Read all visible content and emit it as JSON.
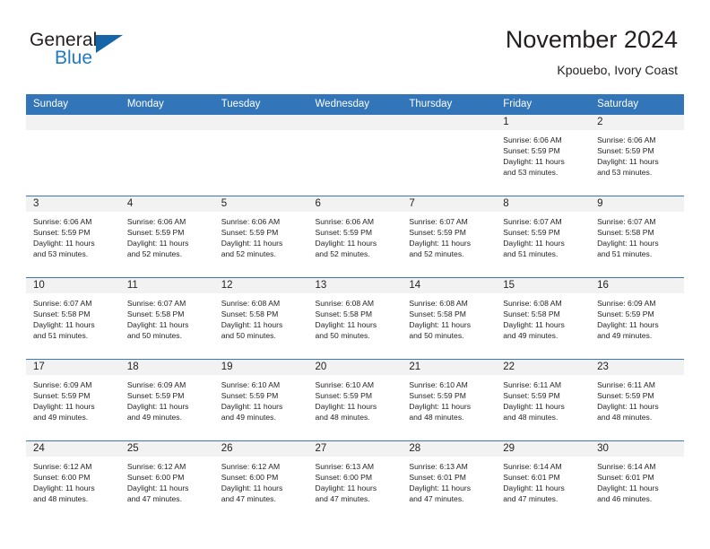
{
  "brand": {
    "name_part1": "General",
    "name_part2": "Blue",
    "flag_icon": "triangle-flag-icon"
  },
  "header": {
    "title": "November 2024",
    "location": "Kpouebo, Ivory Coast"
  },
  "colors": {
    "header_blue": "#3275b8",
    "brand_blue": "#1f7ac4",
    "flag_blue": "#1565a8",
    "daynum_bg": "#f2f2f2",
    "row_divider": "#3b78b5",
    "text": "#231f20"
  },
  "weekday_headers": [
    "Sunday",
    "Monday",
    "Tuesday",
    "Wednesday",
    "Thursday",
    "Friday",
    "Saturday"
  ],
  "labels": {
    "sunrise": "Sunrise:",
    "sunset": "Sunset:",
    "daylight": "Daylight:"
  },
  "weeks": [
    [
      {
        "day": "",
        "blank": true,
        "line1": "",
        "line2": "",
        "line3": "",
        "line4": ""
      },
      {
        "day": "",
        "blank": true,
        "line1": "",
        "line2": "",
        "line3": "",
        "line4": ""
      },
      {
        "day": "",
        "blank": true,
        "line1": "",
        "line2": "",
        "line3": "",
        "line4": ""
      },
      {
        "day": "",
        "blank": true,
        "line1": "",
        "line2": "",
        "line3": "",
        "line4": ""
      },
      {
        "day": "",
        "blank": true,
        "line1": "",
        "line2": "",
        "line3": "",
        "line4": ""
      },
      {
        "day": "1",
        "blank": false,
        "line1": "Sunrise: 6:06 AM",
        "line2": "Sunset: 5:59 PM",
        "line3": "Daylight: 11 hours",
        "line4": "and 53 minutes."
      },
      {
        "day": "2",
        "blank": false,
        "line1": "Sunrise: 6:06 AM",
        "line2": "Sunset: 5:59 PM",
        "line3": "Daylight: 11 hours",
        "line4": "and 53 minutes."
      }
    ],
    [
      {
        "day": "3",
        "blank": false,
        "line1": "Sunrise: 6:06 AM",
        "line2": "Sunset: 5:59 PM",
        "line3": "Daylight: 11 hours",
        "line4": "and 53 minutes."
      },
      {
        "day": "4",
        "blank": false,
        "line1": "Sunrise: 6:06 AM",
        "line2": "Sunset: 5:59 PM",
        "line3": "Daylight: 11 hours",
        "line4": "and 52 minutes."
      },
      {
        "day": "5",
        "blank": false,
        "line1": "Sunrise: 6:06 AM",
        "line2": "Sunset: 5:59 PM",
        "line3": "Daylight: 11 hours",
        "line4": "and 52 minutes."
      },
      {
        "day": "6",
        "blank": false,
        "line1": "Sunrise: 6:06 AM",
        "line2": "Sunset: 5:59 PM",
        "line3": "Daylight: 11 hours",
        "line4": "and 52 minutes."
      },
      {
        "day": "7",
        "blank": false,
        "line1": "Sunrise: 6:07 AM",
        "line2": "Sunset: 5:59 PM",
        "line3": "Daylight: 11 hours",
        "line4": "and 52 minutes."
      },
      {
        "day": "8",
        "blank": false,
        "line1": "Sunrise: 6:07 AM",
        "line2": "Sunset: 5:59 PM",
        "line3": "Daylight: 11 hours",
        "line4": "and 51 minutes."
      },
      {
        "day": "9",
        "blank": false,
        "line1": "Sunrise: 6:07 AM",
        "line2": "Sunset: 5:58 PM",
        "line3": "Daylight: 11 hours",
        "line4": "and 51 minutes."
      }
    ],
    [
      {
        "day": "10",
        "blank": false,
        "line1": "Sunrise: 6:07 AM",
        "line2": "Sunset: 5:58 PM",
        "line3": "Daylight: 11 hours",
        "line4": "and 51 minutes."
      },
      {
        "day": "11",
        "blank": false,
        "line1": "Sunrise: 6:07 AM",
        "line2": "Sunset: 5:58 PM",
        "line3": "Daylight: 11 hours",
        "line4": "and 50 minutes."
      },
      {
        "day": "12",
        "blank": false,
        "line1": "Sunrise: 6:08 AM",
        "line2": "Sunset: 5:58 PM",
        "line3": "Daylight: 11 hours",
        "line4": "and 50 minutes."
      },
      {
        "day": "13",
        "blank": false,
        "line1": "Sunrise: 6:08 AM",
        "line2": "Sunset: 5:58 PM",
        "line3": "Daylight: 11 hours",
        "line4": "and 50 minutes."
      },
      {
        "day": "14",
        "blank": false,
        "line1": "Sunrise: 6:08 AM",
        "line2": "Sunset: 5:58 PM",
        "line3": "Daylight: 11 hours",
        "line4": "and 50 minutes."
      },
      {
        "day": "15",
        "blank": false,
        "line1": "Sunrise: 6:08 AM",
        "line2": "Sunset: 5:58 PM",
        "line3": "Daylight: 11 hours",
        "line4": "and 49 minutes."
      },
      {
        "day": "16",
        "blank": false,
        "line1": "Sunrise: 6:09 AM",
        "line2": "Sunset: 5:59 PM",
        "line3": "Daylight: 11 hours",
        "line4": "and 49 minutes."
      }
    ],
    [
      {
        "day": "17",
        "blank": false,
        "line1": "Sunrise: 6:09 AM",
        "line2": "Sunset: 5:59 PM",
        "line3": "Daylight: 11 hours",
        "line4": "and 49 minutes."
      },
      {
        "day": "18",
        "blank": false,
        "line1": "Sunrise: 6:09 AM",
        "line2": "Sunset: 5:59 PM",
        "line3": "Daylight: 11 hours",
        "line4": "and 49 minutes."
      },
      {
        "day": "19",
        "blank": false,
        "line1": "Sunrise: 6:10 AM",
        "line2": "Sunset: 5:59 PM",
        "line3": "Daylight: 11 hours",
        "line4": "and 49 minutes."
      },
      {
        "day": "20",
        "blank": false,
        "line1": "Sunrise: 6:10 AM",
        "line2": "Sunset: 5:59 PM",
        "line3": "Daylight: 11 hours",
        "line4": "and 48 minutes."
      },
      {
        "day": "21",
        "blank": false,
        "line1": "Sunrise: 6:10 AM",
        "line2": "Sunset: 5:59 PM",
        "line3": "Daylight: 11 hours",
        "line4": "and 48 minutes."
      },
      {
        "day": "22",
        "blank": false,
        "line1": "Sunrise: 6:11 AM",
        "line2": "Sunset: 5:59 PM",
        "line3": "Daylight: 11 hours",
        "line4": "and 48 minutes."
      },
      {
        "day": "23",
        "blank": false,
        "line1": "Sunrise: 6:11 AM",
        "line2": "Sunset: 5:59 PM",
        "line3": "Daylight: 11 hours",
        "line4": "and 48 minutes."
      }
    ],
    [
      {
        "day": "24",
        "blank": false,
        "line1": "Sunrise: 6:12 AM",
        "line2": "Sunset: 6:00 PM",
        "line3": "Daylight: 11 hours",
        "line4": "and 48 minutes."
      },
      {
        "day": "25",
        "blank": false,
        "line1": "Sunrise: 6:12 AM",
        "line2": "Sunset: 6:00 PM",
        "line3": "Daylight: 11 hours",
        "line4": "and 47 minutes."
      },
      {
        "day": "26",
        "blank": false,
        "line1": "Sunrise: 6:12 AM",
        "line2": "Sunset: 6:00 PM",
        "line3": "Daylight: 11 hours",
        "line4": "and 47 minutes."
      },
      {
        "day": "27",
        "blank": false,
        "line1": "Sunrise: 6:13 AM",
        "line2": "Sunset: 6:00 PM",
        "line3": "Daylight: 11 hours",
        "line4": "and 47 minutes."
      },
      {
        "day": "28",
        "blank": false,
        "line1": "Sunrise: 6:13 AM",
        "line2": "Sunset: 6:01 PM",
        "line3": "Daylight: 11 hours",
        "line4": "and 47 minutes."
      },
      {
        "day": "29",
        "blank": false,
        "line1": "Sunrise: 6:14 AM",
        "line2": "Sunset: 6:01 PM",
        "line3": "Daylight: 11 hours",
        "line4": "and 47 minutes."
      },
      {
        "day": "30",
        "blank": false,
        "line1": "Sunrise: 6:14 AM",
        "line2": "Sunset: 6:01 PM",
        "line3": "Daylight: 11 hours",
        "line4": "and 46 minutes."
      }
    ]
  ]
}
